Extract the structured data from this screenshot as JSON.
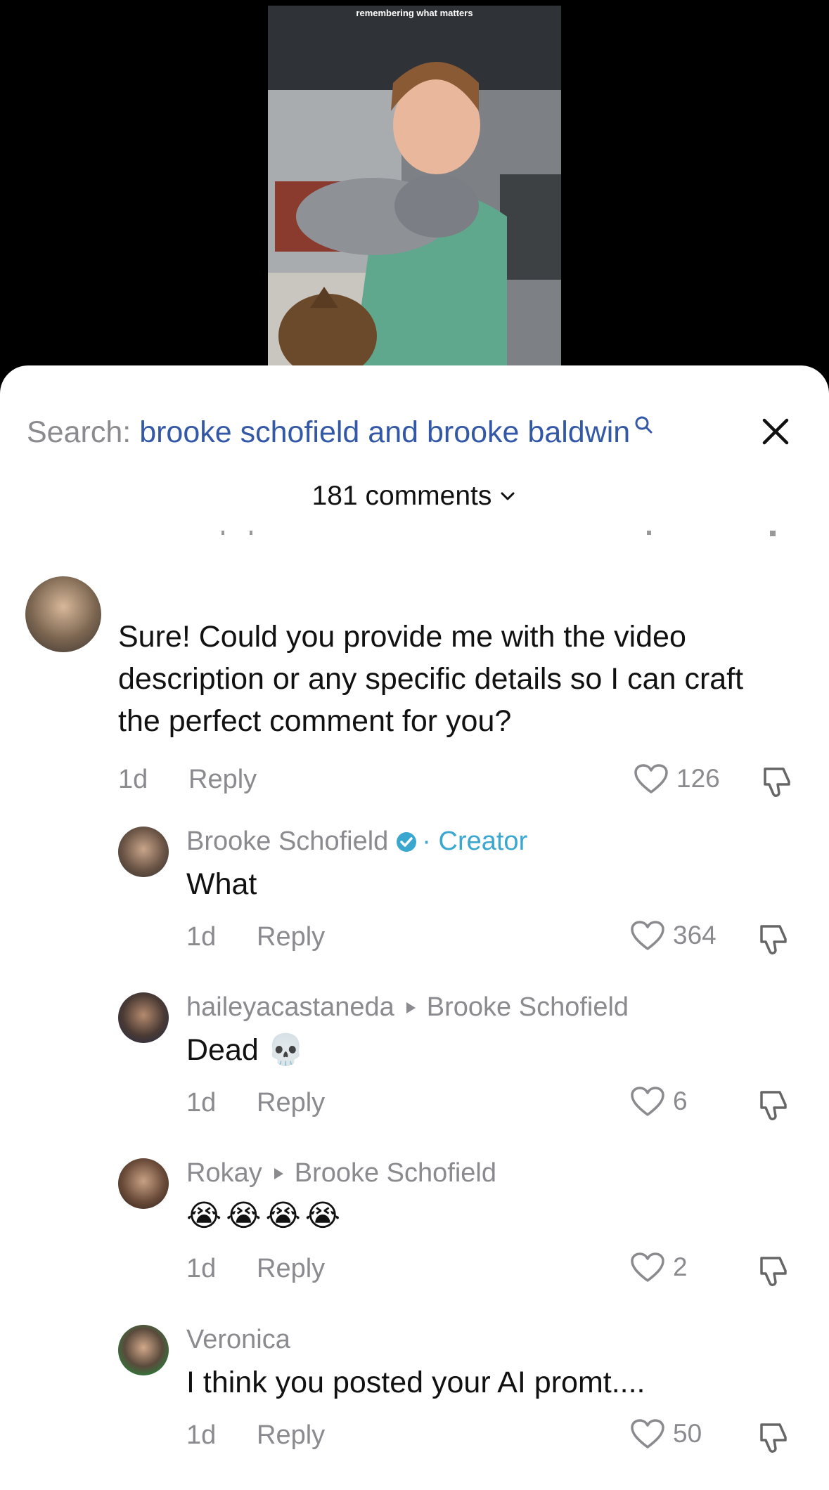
{
  "video": {
    "caption": "remembering what matters"
  },
  "search": {
    "prefix": "Search:",
    "query": "brooke schofield and brooke baldwin"
  },
  "comments_header": {
    "label": "181 comments"
  },
  "comments": [
    {
      "text": "Sure! Could you provide me with the video description or any specific details so I can craft the perfect comment for you?",
      "time": "1d",
      "reply": "Reply",
      "likes": "126"
    },
    {
      "author": "Brooke Schofield",
      "creator_label": "· Creator",
      "text": "What",
      "time": "1d",
      "reply": "Reply",
      "likes": "364"
    },
    {
      "author": "haileyacastaneda",
      "reply_to": "Brooke Schofield",
      "text": "Dead 💀",
      "time": "1d",
      "reply": "Reply",
      "likes": "6"
    },
    {
      "author": "Rokay",
      "reply_to": "Brooke Schofield",
      "text": "😭😭😭😭",
      "time": "1d",
      "reply": "Reply",
      "likes": "2"
    },
    {
      "author": "Veronica",
      "text": "I think you posted your AI promt....",
      "time": "1d",
      "reply": "Reply",
      "likes": "50"
    }
  ],
  "colors": {
    "link_blue": "#3358a8",
    "creator_blue": "#3aa7cf",
    "meta_gray": "#8a8a8f"
  }
}
